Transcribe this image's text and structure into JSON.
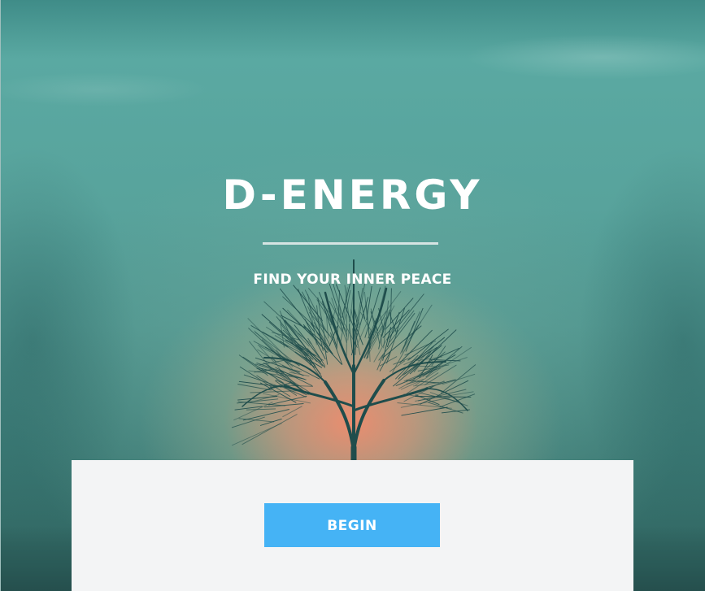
{
  "hero": {
    "title": "D-ENERGY",
    "tagline": "FIND YOUR INNER PEACE",
    "colors": {
      "sky_top": "#3f8c88",
      "sky_mid": "#58a39c",
      "sunset_glow": "#f08c6e",
      "tree": "#1f4d4c"
    }
  },
  "panel": {
    "begin_label": "BEGIN",
    "button_color": "#45b3f5",
    "background": "#f3f4f5"
  }
}
